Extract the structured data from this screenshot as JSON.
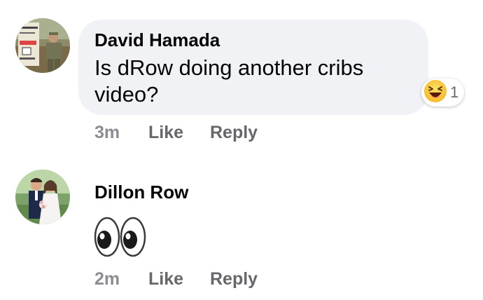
{
  "comments": [
    {
      "author": "David Hamada",
      "text_line1": "Is dRow doing another cribs",
      "text_line2": "video?",
      "reaction": {
        "icon": "laughing-face-emoji",
        "count": "1"
      },
      "time": "3m",
      "like_label": "Like",
      "reply_label": "Reply",
      "avatar": "soldier-photo-avatar"
    },
    {
      "author": "Dillon Row",
      "text_emoji": "eyes-emoji",
      "time": "2m",
      "like_label": "Like",
      "reply_label": "Reply",
      "avatar": "wedding-photo-avatar"
    }
  ],
  "colors": {
    "bubble_bg": "#f0f2f5",
    "meta_text": "#65676b",
    "name_text": "#050505"
  }
}
